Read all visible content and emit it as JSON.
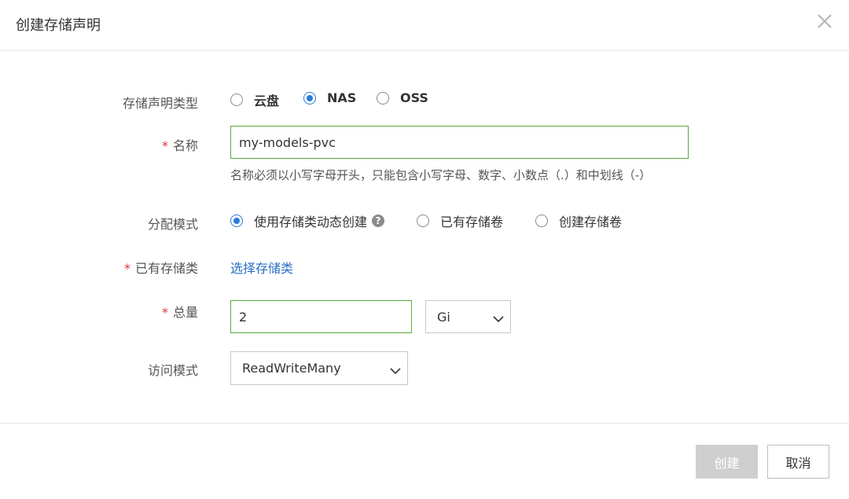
{
  "dialog": {
    "title": "创建存储声明"
  },
  "form": {
    "type": {
      "label": "存储声明类型",
      "options": [
        "云盘",
        "NAS",
        "OSS"
      ],
      "selected": "NAS"
    },
    "name": {
      "label": "名称",
      "value": "my-models-pvc",
      "help": "名称必须以小写字母开头，只能包含小写字母、数字、小数点（.）和中划线（-）"
    },
    "mode": {
      "label": "分配模式",
      "options": [
        "使用存储类动态创建",
        "已有存储卷",
        "创建存储卷"
      ],
      "selected": "使用存储类动态创建",
      "help_icon": "?"
    },
    "storage_class": {
      "label": "已有存储类",
      "link": "选择存储类"
    },
    "capacity": {
      "label": "总量",
      "value": "2",
      "unit": "Gi"
    },
    "access": {
      "label": "访问模式",
      "value": "ReadWriteMany"
    }
  },
  "footer": {
    "create": "创建",
    "cancel": "取消"
  },
  "icons": {
    "close": "close-icon",
    "chevron": "chevron-down-icon",
    "help": "question-circle-icon"
  },
  "colors": {
    "accent": "#2a7bd6",
    "link": "#2a6fc6",
    "input_border": "#58ac3c",
    "required": "#e0333a",
    "disabled": "#cfcfcf"
  }
}
